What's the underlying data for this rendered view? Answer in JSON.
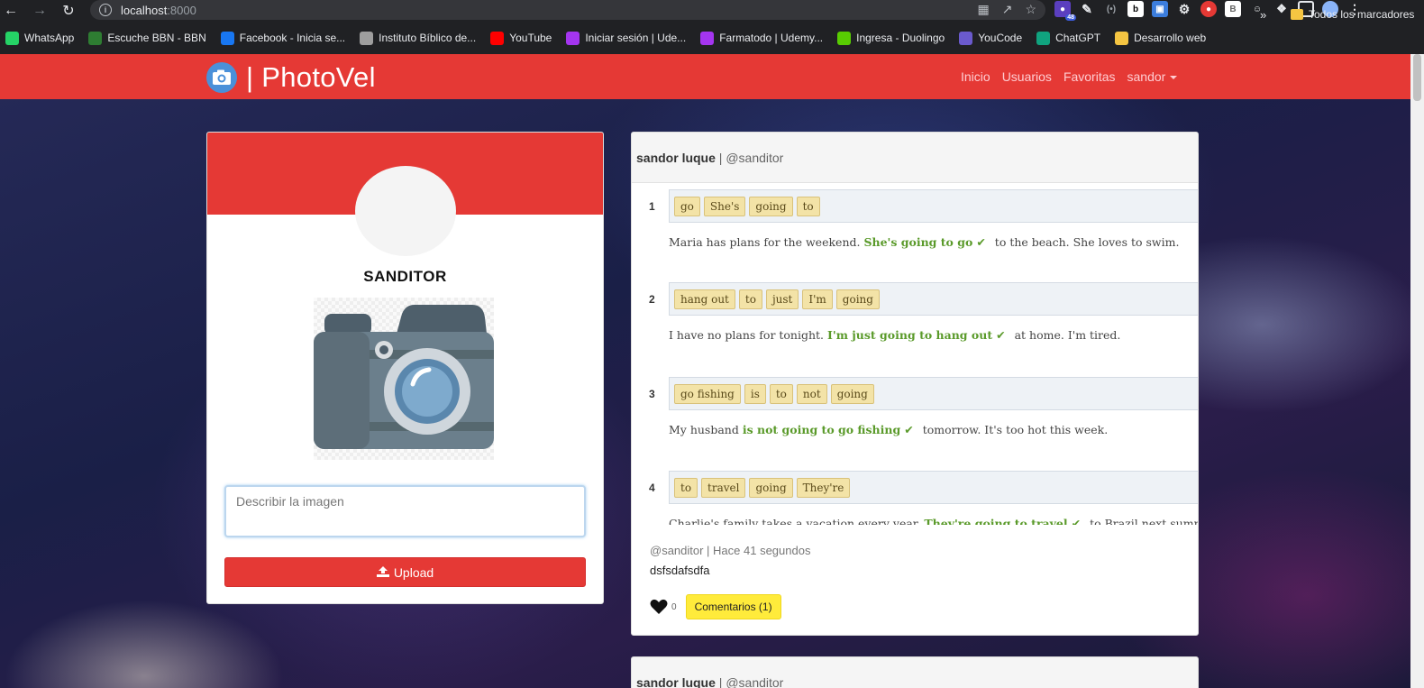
{
  "browser": {
    "url_host": "localhost",
    "url_port": ":8000",
    "extension_badge": "48",
    "bookmarks": [
      {
        "label": "WhatsApp",
        "color": "#25d366"
      },
      {
        "label": "Escuche BBN - BBN",
        "color": "#2e7d32"
      },
      {
        "label": "Facebook - Inicia se...",
        "color": "#1877f2"
      },
      {
        "label": "Instituto Bíblico de...",
        "color": "#9e9e9e"
      },
      {
        "label": "YouTube",
        "color": "#ff0000"
      },
      {
        "label": "Iniciar sesión | Ude...",
        "color": "#a435f0"
      },
      {
        "label": "Farmatodo | Udemy...",
        "color": "#a435f0"
      },
      {
        "label": "Ingresa - Duolingo",
        "color": "#58cc02"
      },
      {
        "label": "YouCode",
        "color": "#6a5acd"
      },
      {
        "label": "ChatGPT",
        "color": "#10a37f"
      },
      {
        "label": "Desarrollo web",
        "color": "#f5c542"
      }
    ],
    "more": "»",
    "all_bookmarks": "Todos los marcadores"
  },
  "navbar": {
    "brand": "| PhotoVel",
    "links": [
      "Inicio",
      "Usuarios",
      "Favoritas"
    ],
    "user_menu": "sandor"
  },
  "profile": {
    "username": "SANDITOR",
    "description_placeholder": "Describir la imagen",
    "upload_label": "Upload"
  },
  "post": {
    "author_name": "sandor luque",
    "author_handle": "| @sanditor",
    "exercises": [
      {
        "num": "1",
        "chips": [
          "go",
          "She's",
          "going",
          "to"
        ],
        "before": "Maria has plans for the weekend.",
        "answer": "She's going to go",
        "after": "to the beach. She loves to swim."
      },
      {
        "num": "2",
        "chips": [
          "hang out",
          "to",
          "just",
          "I'm",
          "going"
        ],
        "before": "I have no plans for tonight.",
        "answer": "I'm just going to hang out",
        "after": "at home. I'm tired."
      },
      {
        "num": "3",
        "chips": [
          "go fishing",
          "is",
          "to",
          "not",
          "going"
        ],
        "before": "My husband",
        "answer": "is not going to go fishing",
        "after": "tomorrow. It's too hot this week."
      },
      {
        "num": "4",
        "chips": [
          "to",
          "travel",
          "going",
          "They're"
        ],
        "before": "Charlie's family takes a vacation every year.",
        "answer": "They're going to travel",
        "after": "to Brazil next summer."
      }
    ],
    "meta": "@sanditor | Hace 41 segundos",
    "description": "dsfsdafsdfa",
    "likes": "0",
    "comments_label": "Comentarios (1)"
  },
  "post2": {
    "author_name": "sandor luque",
    "author_handle": "| @sanditor"
  },
  "colors": {
    "brand_red": "#e53935",
    "comments_yellow": "#ffeb3b",
    "answer_green": "#5a9a2a"
  }
}
